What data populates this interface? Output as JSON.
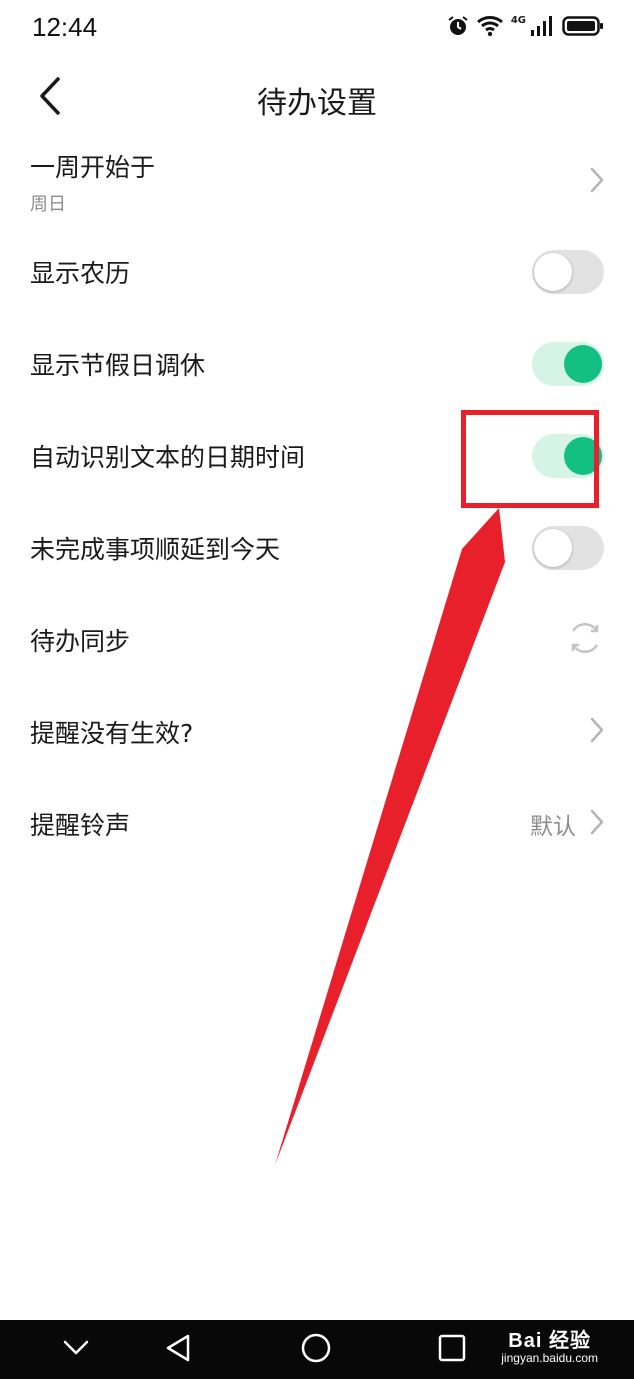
{
  "status_bar": {
    "time": "12:44",
    "network": "4G"
  },
  "header": {
    "title": "待办设置"
  },
  "settings": [
    {
      "label": "一周开始于",
      "sub": "周日"
    },
    {
      "label": "显示农历",
      "toggle": "off"
    },
    {
      "label": "显示节假日调休",
      "toggle": "on"
    },
    {
      "label": "自动识别文本的日期时间",
      "toggle": "on"
    },
    {
      "label": "未完成事项顺延到今天",
      "toggle": "off"
    },
    {
      "label": "待办同步"
    },
    {
      "label": "提醒没有生效?"
    },
    {
      "label": "提醒铃声",
      "value": "默认"
    }
  ],
  "colors": {
    "accent": "#13bf83",
    "annotation": "#e8202c"
  },
  "watermark": {
    "line1": "Bai 经验",
    "line2": "jingyan.baidu.com"
  }
}
